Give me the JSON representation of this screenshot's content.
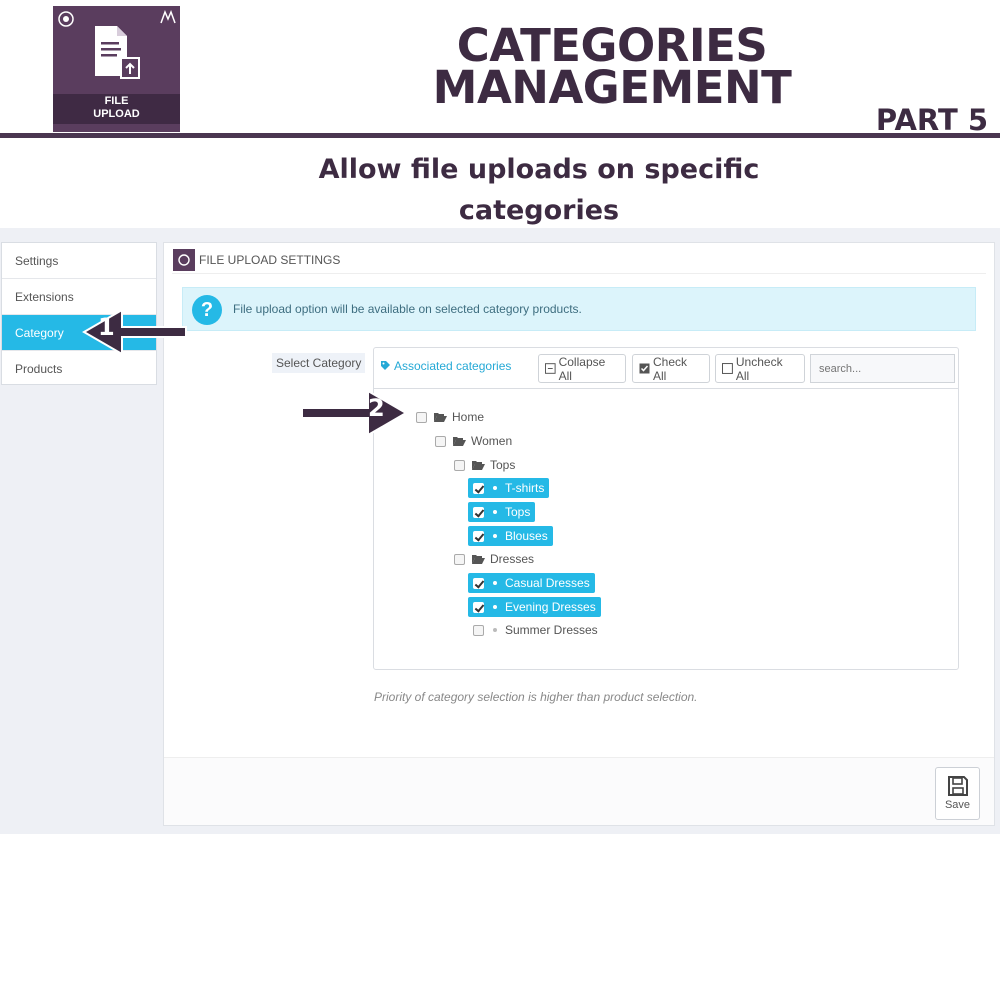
{
  "header": {
    "logo_text": "FILE UPLOAD",
    "title_line1": "CATEGORIES",
    "title_line2": "MANAGEMENT",
    "part": "PART 5",
    "subtitle_line1": "Allow file uploads on specific",
    "subtitle_line2": "categories"
  },
  "sidebar": {
    "items": [
      {
        "label": "Settings",
        "active": false
      },
      {
        "label": "Extensions",
        "active": false
      },
      {
        "label": "Category",
        "active": true
      },
      {
        "label": "Products",
        "active": false
      }
    ]
  },
  "panel": {
    "title": "FILE UPLOAD SETTINGS",
    "info_text": "File upload option will be available on selected category products.",
    "select_label": "Select Category",
    "associated_label": "Associated categories",
    "collapse_label": "Collapse All",
    "check_label": "Check All",
    "uncheck_label": "Uncheck All",
    "search_placeholder": "search...",
    "note": "Priority of category selection is higher than product selection.",
    "save_label": "Save"
  },
  "tree": [
    {
      "label": "Home",
      "checked": false,
      "type": "folder"
    },
    {
      "label": "Women",
      "checked": false,
      "type": "folder"
    },
    {
      "label": "Tops",
      "checked": false,
      "type": "folder"
    },
    {
      "label": "T-shirts",
      "checked": true,
      "type": "leaf"
    },
    {
      "label": "Tops",
      "checked": true,
      "type": "leaf"
    },
    {
      "label": "Blouses",
      "checked": true,
      "type": "leaf"
    },
    {
      "label": "Dresses",
      "checked": false,
      "type": "folder"
    },
    {
      "label": "Casual Dresses",
      "checked": true,
      "type": "leaf"
    },
    {
      "label": "Evening Dresses",
      "checked": true,
      "type": "leaf"
    },
    {
      "label": "Summer Dresses",
      "checked": false,
      "type": "leaf"
    }
  ],
  "annotations": {
    "step1": "1",
    "step2": "2"
  },
  "colors": {
    "brand": "#3d2b42",
    "accent": "#25b9e6"
  }
}
